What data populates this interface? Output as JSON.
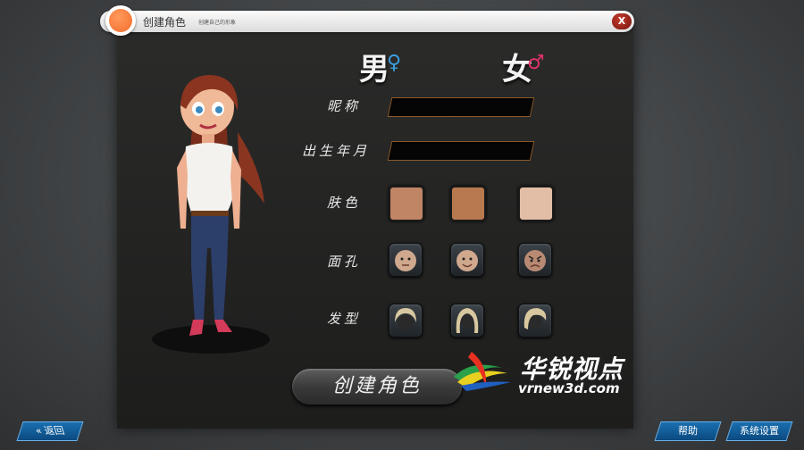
{
  "title": {
    "main": "创建角色",
    "sub": "创建自己的形象",
    "close_label": "X"
  },
  "gender": {
    "male": "男",
    "female": "女",
    "male_symbol": "♀",
    "female_symbol": "♂"
  },
  "form": {
    "nickname_label": "昵称",
    "birth_label": "出生年月",
    "skin_label": "肤色",
    "face_label": "面孔",
    "hair_label": "发型"
  },
  "skin_colors": [
    "#c08565",
    "#b8794f",
    "#e3bea7"
  ],
  "faces": [
    "neutral-face-icon",
    "smiling-face-icon",
    "angry-face-icon"
  ],
  "hairs": [
    "short-hair-icon",
    "long-hair-icon",
    "side-hair-icon"
  ],
  "create_button": "创建角色",
  "bottom": {
    "back": "返回",
    "help": "帮助",
    "settings": "系统设置"
  },
  "watermark": {
    "brand": "华锐视点",
    "url": "vrnew3d.com"
  },
  "colors": {
    "accent": "#f26d2d",
    "close": "#9b2016",
    "field_border": "#8a5a2a",
    "blue_button": "#0b4a80"
  }
}
